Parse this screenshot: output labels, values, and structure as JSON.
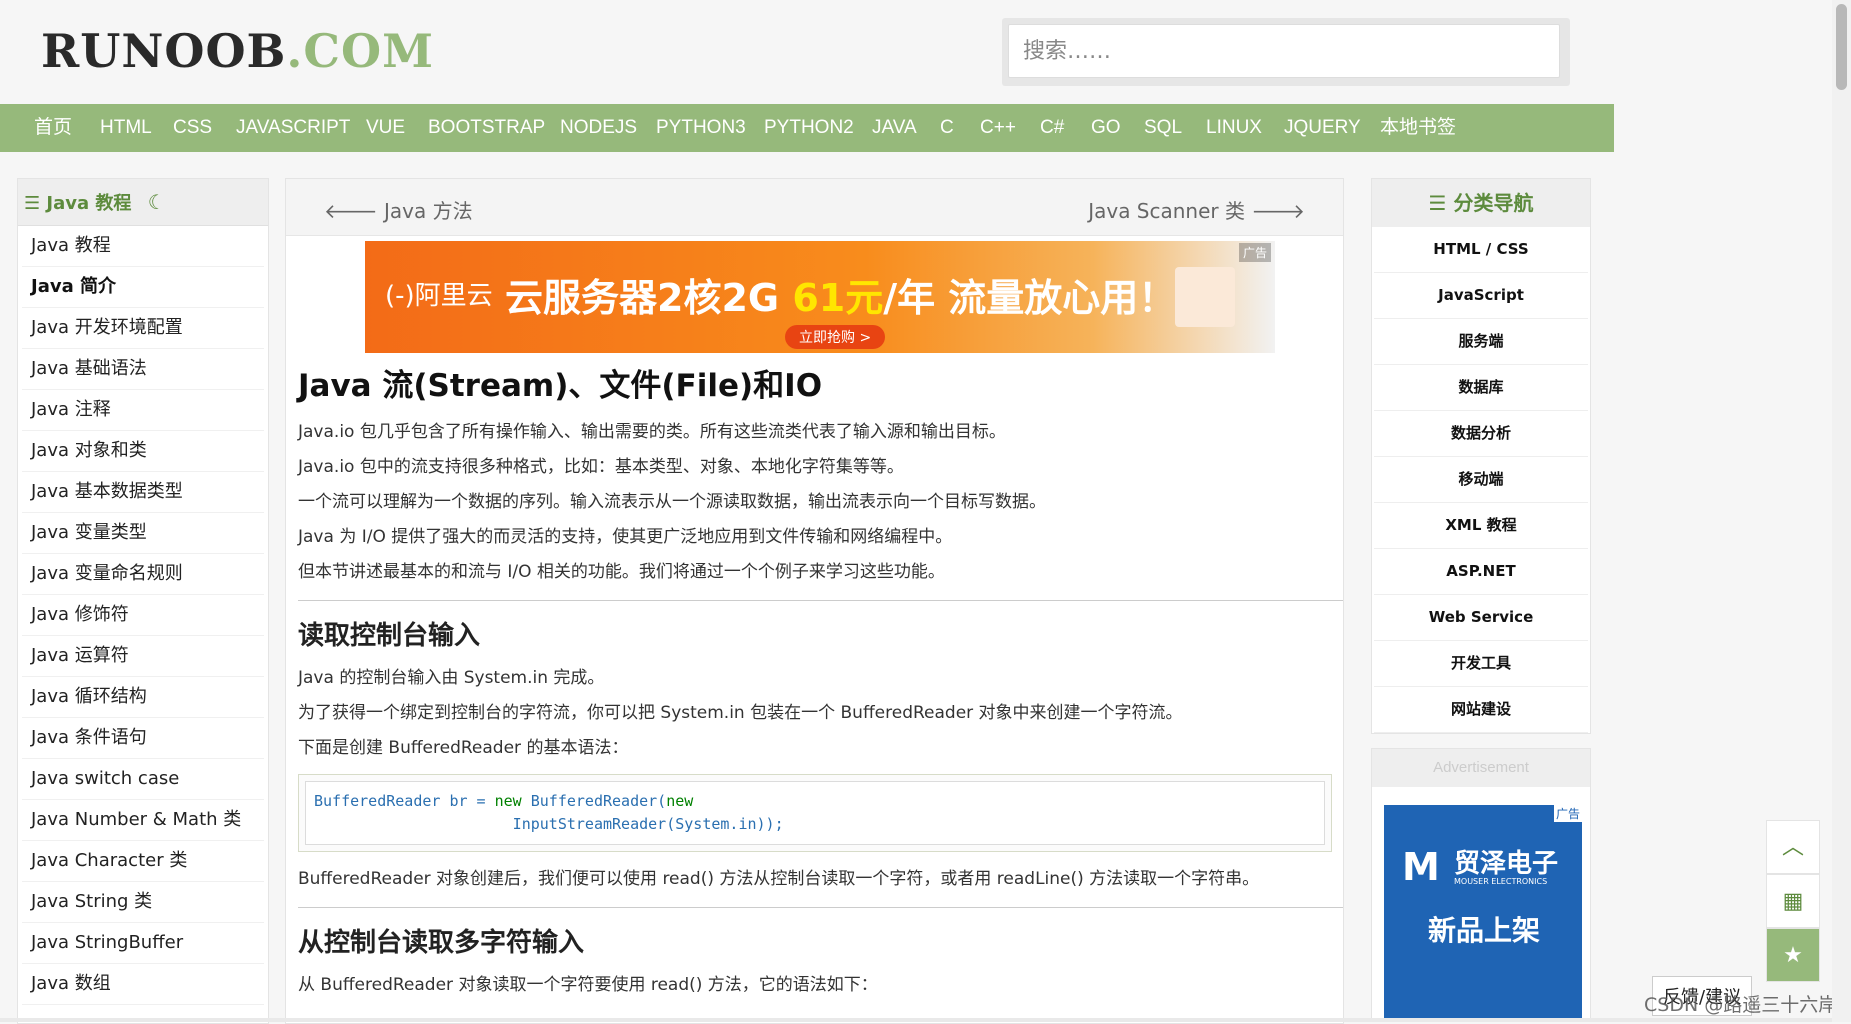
{
  "header": {
    "logo_main": "RUNOOB",
    "logo_dot": ".COM",
    "search_placeholder": "搜索……"
  },
  "nav": [
    "首页",
    "HTML",
    "CSS",
    "JAVASCRIPT",
    "VUE",
    "BOOTSTRAP",
    "NODEJS",
    "PYTHON3",
    "PYTHON2",
    "JAVA",
    "C",
    "C++",
    "C#",
    "GO",
    "SQL",
    "LINUX",
    "JQUERY",
    "本地书签"
  ],
  "left_sidebar": {
    "title": "Java 教程",
    "moon_icon": "☾",
    "items": [
      "Java 教程",
      "Java 简介",
      "Java 开发环境配置",
      "Java 基础语法",
      "Java 注释",
      "Java 对象和类",
      "Java 基本数据类型",
      "Java 变量类型",
      "Java 变量命名规则",
      "Java 修饰符",
      "Java 运算符",
      "Java 循环结构",
      "Java 条件语句",
      "Java switch case",
      "Java Number & Math 类",
      "Java Character 类",
      "Java String 类",
      "Java StringBuffer",
      "Java 数组"
    ],
    "active_index": 1
  },
  "main": {
    "prev_label": "Java 方法",
    "next_label": "Java Scanner 类",
    "ad": {
      "brand": "(-)阿里云",
      "text_a": "云服务器2核2G ",
      "price": "61元",
      "text_b": "/年 流量放心用！",
      "button": "立即抢购 >",
      "tag": "广告"
    },
    "title": "Java 流(Stream)、文件(File)和IO",
    "intro": [
      "Java.io 包几乎包含了所有操作输入、输出需要的类。所有这些流类代表了输入源和输出目标。",
      "Java.io 包中的流支持很多种格式，比如：基本类型、对象、本地化字符集等等。",
      "一个流可以理解为一个数据的序列。输入流表示从一个源读取数据，输出流表示向一个目标写数据。",
      "Java 为 I/O 提供了强大的而灵活的支持，使其更广泛地应用到文件传输和网络编程中。",
      "但本节讲述最基本的和流与 I/O 相关的功能。我们将通过一个个例子来学习这些功能。"
    ],
    "section1": {
      "heading": "读取控制台输入",
      "paras": [
        "Java 的控制台输入由 System.in 完成。",
        "为了获得一个绑定到控制台的字符流，你可以把 System.in 包装在一个 BufferedReader 对象中来创建一个字符流。",
        "下面是创建 BufferedReader 的基本语法："
      ],
      "code_line1_a": "BufferedReader br = ",
      "code_line1_kw": "new",
      "code_line1_b": " BufferedReader(",
      "code_line1_kw2": "new",
      "code_line2": "                      InputStreamReader(System.in));",
      "after": "BufferedReader 对象创建后，我们便可以使用 read() 方法从控制台读取一个字符，或者用 readLine() 方法读取一个字符串。"
    },
    "section2": {
      "heading": "从控制台读取多字符输入",
      "para": "从 BufferedReader 对象读取一个字符要使用 read() 方法，它的语法如下："
    }
  },
  "right_sidebar": {
    "title": "分类导航",
    "items": [
      "HTML / CSS",
      "JavaScript",
      "服务端",
      "数据库",
      "数据分析",
      "移动端",
      "XML 教程",
      "ASP.NET",
      "Web Service",
      "开发工具",
      "网站建设"
    ],
    "advert_label": "Advertisement",
    "advert": {
      "logo": "M",
      "name": "贸泽电子",
      "sub": "MOUSER ELECTRONICS",
      "headline": "新品上架",
      "tag": "广告"
    }
  },
  "floating": {
    "up_icon": "︿",
    "qr_icon": "▦",
    "star_icon": "★",
    "feedback": "反馈/建议"
  },
  "watermark": "CSDN @路遥三十六岸"
}
